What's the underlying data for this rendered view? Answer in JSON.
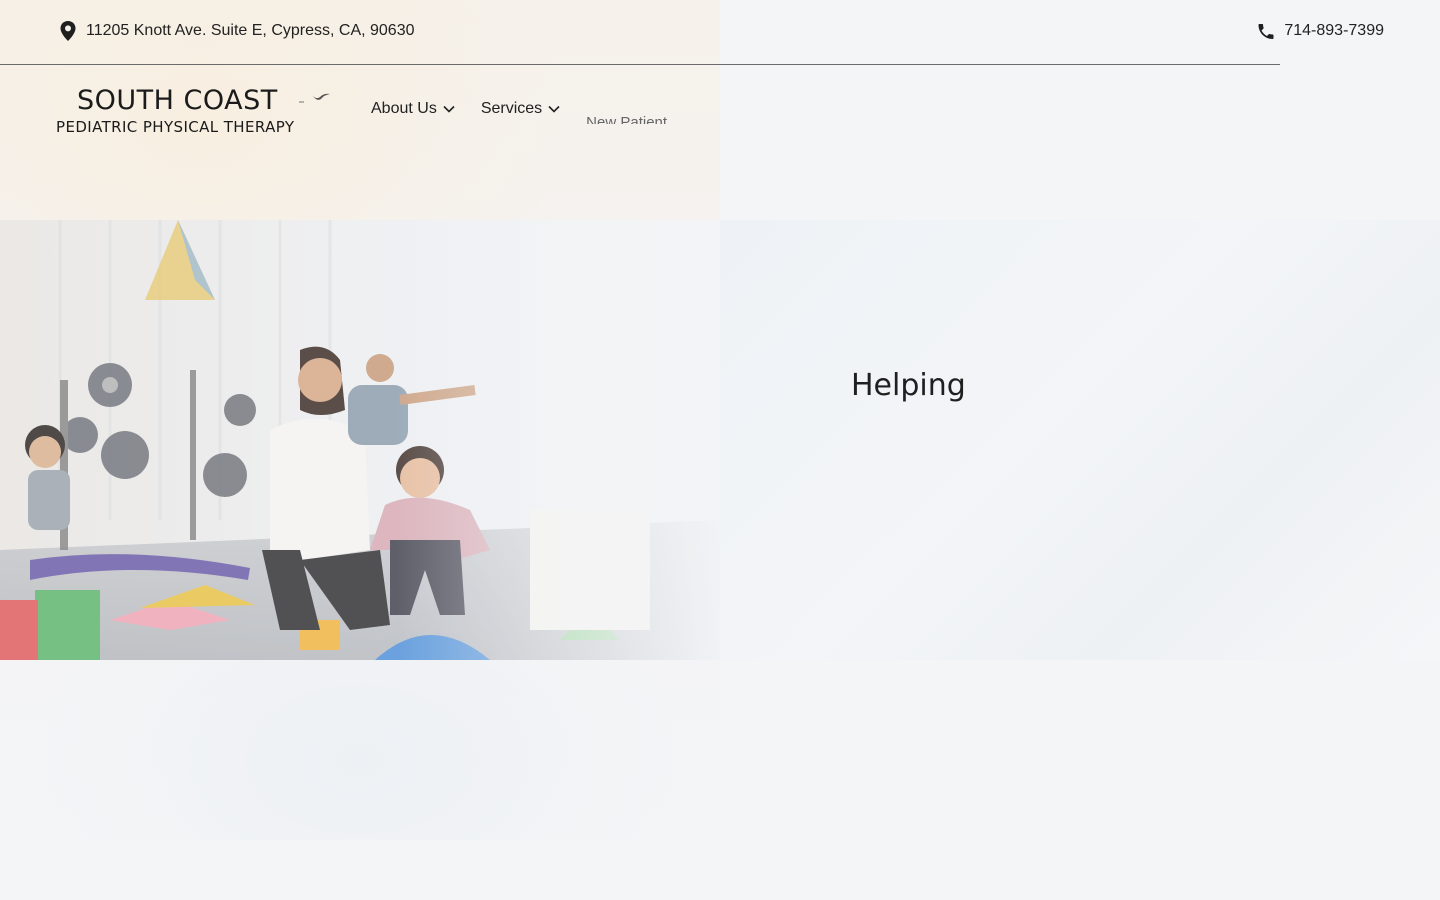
{
  "topbar": {
    "address": "11205 Knott Ave. Suite E, Cypress, CA, 90630",
    "phone": "714-893-7399",
    "address_icon": "map-pin-icon",
    "phone_icon": "phone-icon"
  },
  "logo": {
    "title": "SOUTH COAST",
    "subtitle": "PEDIATRIC PHYSICAL THERAPY"
  },
  "nav": {
    "items": [
      {
        "label": "About Us",
        "has_dropdown": true
      },
      {
        "label": "Services",
        "has_dropdown": true
      },
      {
        "label": "New Patient",
        "has_dropdown": false
      }
    ]
  },
  "hero": {
    "heading": "Helping"
  },
  "colors": {
    "text": "#1f1f1f",
    "background": "#f4f5f7",
    "divider": "#6b6b6b"
  }
}
